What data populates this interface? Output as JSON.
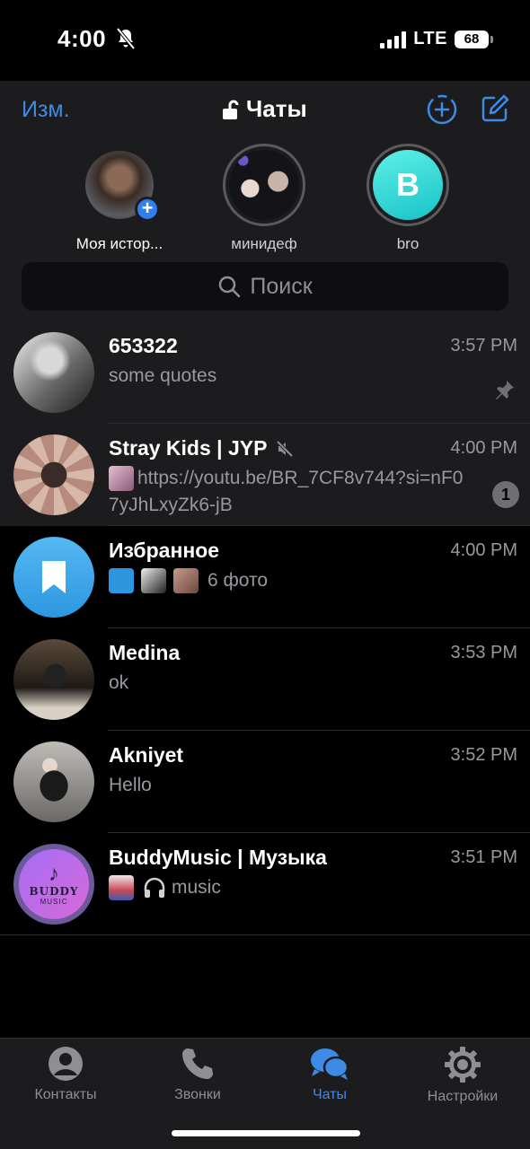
{
  "status_bar": {
    "time": "4:00",
    "network": "LTE",
    "battery": "68"
  },
  "nav": {
    "edit_label": "Изм.",
    "title": "Чаты"
  },
  "stories": [
    {
      "label": "Моя истор..."
    },
    {
      "label": "минидеф"
    },
    {
      "label": "bro",
      "initial": "B"
    }
  ],
  "search": {
    "placeholder": "Поиск"
  },
  "chats": [
    {
      "name": "653322",
      "time": "3:57 PM",
      "message": "some quotes",
      "pinned": true
    },
    {
      "name": "Stray Kids | JYP",
      "time": "4:00 PM",
      "message": "https://youtu.be/BR_7CF8v744?si=nF07yJhLxyZk6-jB",
      "muted": true,
      "unread": "1"
    },
    {
      "name": "Избранное",
      "time": "4:00 PM",
      "message": "6 фото"
    },
    {
      "name": "Medina",
      "time": "3:53 PM",
      "message": "ok"
    },
    {
      "name": "Akniyet",
      "time": "3:52 PM",
      "message": "Hello"
    },
    {
      "name": "BuddyMusic | Музыка",
      "time": "3:51 PM",
      "message": "music",
      "avatar_text": "BUDDY",
      "avatar_subtext": "MUSIC"
    }
  ],
  "tabs": [
    {
      "label": "Контакты"
    },
    {
      "label": "Звонки"
    },
    {
      "label": "Чаты",
      "active": true
    },
    {
      "label": "Настройки"
    }
  ],
  "colors": {
    "accent": "#3e8be6",
    "background": "#000000",
    "surface": "#1c1c1e",
    "secondary_text": "#98989e"
  }
}
